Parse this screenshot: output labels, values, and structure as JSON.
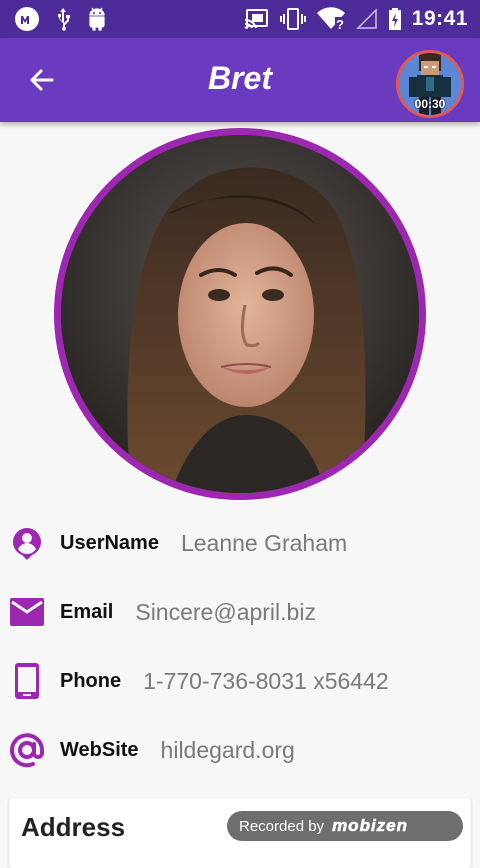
{
  "status_bar": {
    "left_icons": [
      "mobizen-icon",
      "usb-icon",
      "android-icon"
    ],
    "right_icons": [
      "cast-icon",
      "vibrate-icon",
      "wifi-icon",
      "no-signal-icon",
      "battery-charging-icon"
    ],
    "time": "19:41"
  },
  "app_bar": {
    "title": "Bret",
    "recording_time": "00:30"
  },
  "profile": {
    "rows": [
      {
        "icon": "account-pin-icon",
        "label": "UserName",
        "value": "Leanne Graham"
      },
      {
        "icon": "email-icon",
        "label": "Email",
        "value": "Sincere@april.biz"
      },
      {
        "icon": "phone-icon",
        "label": "Phone",
        "value": "1-770-736-8031 x56442"
      },
      {
        "icon": "at-sign-icon",
        "label": "WebSite",
        "value": "hildegard.org"
      }
    ]
  },
  "address": {
    "title": "Address"
  },
  "watermark": {
    "text": "Recorded by",
    "brand": "mobizen"
  },
  "colors": {
    "status_bar": "#4d2c9a",
    "app_bar": "#6a3bbf",
    "accent": "#9c27b0"
  }
}
